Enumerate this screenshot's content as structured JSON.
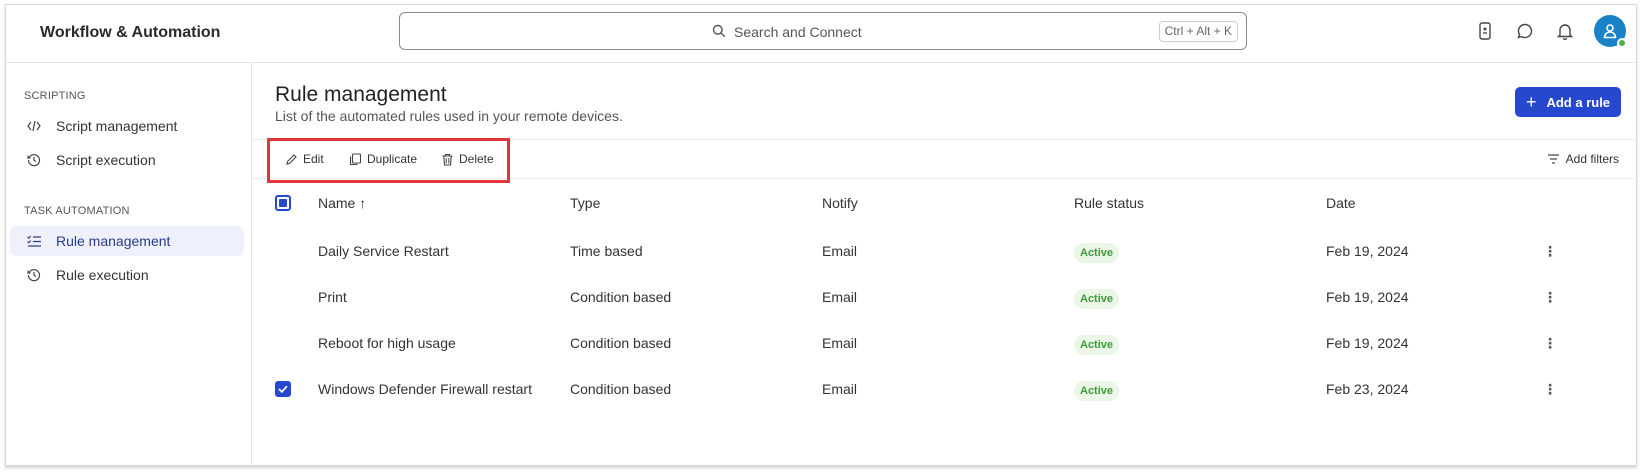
{
  "app": {
    "title": "Workflow & Automation"
  },
  "search": {
    "placeholder": "Search and Connect",
    "shortcut": "Ctrl + Alt + K"
  },
  "header_icons": [
    "device-icon",
    "chat-icon",
    "bell-icon",
    "user-avatar-icon"
  ],
  "sidebar": {
    "sections": [
      {
        "title": "SCRIPTING",
        "items": [
          {
            "label": "Script management",
            "icon": "code-icon"
          },
          {
            "label": "Script execution",
            "icon": "history-icon"
          }
        ]
      },
      {
        "title": "TASK AUTOMATION",
        "items": [
          {
            "label": "Rule management",
            "icon": "checklist-icon",
            "active": true
          },
          {
            "label": "Rule execution",
            "icon": "history-icon"
          }
        ]
      }
    ]
  },
  "main": {
    "title": "Rule management",
    "subtitle": "List of the automated rules used in your remote devices.",
    "add_button": "Add a rule",
    "toolbar": {
      "edit": "Edit",
      "duplicate": "Duplicate",
      "delete": "Delete",
      "filters": "Add filters"
    },
    "table": {
      "headers": {
        "name": "Name ↑",
        "type": "Type",
        "notify": "Notify",
        "status": "Rule status",
        "date": "Date"
      },
      "rows": [
        {
          "name": "Daily Service Restart",
          "type": "Time based",
          "notify": "Email",
          "status": "Active",
          "date": "Feb 19, 2024",
          "checked": false
        },
        {
          "name": "Print",
          "type": "Condition based",
          "notify": "Email",
          "status": "Active",
          "date": "Feb 19, 2024",
          "checked": false
        },
        {
          "name": "Reboot for high usage",
          "type": "Condition based",
          "notify": "Email",
          "status": "Active",
          "date": "Feb 19, 2024",
          "checked": false
        },
        {
          "name": "Windows Defender Firewall restart",
          "type": "Condition based",
          "notify": "Email",
          "status": "Active",
          "date": "Feb 23, 2024",
          "checked": true
        }
      ]
    }
  },
  "colors": {
    "accent": "#2548cf",
    "highlight": "#e0353a",
    "status_active_bg": "#eaf6e6",
    "status_active_text": "#3e9a3a"
  }
}
